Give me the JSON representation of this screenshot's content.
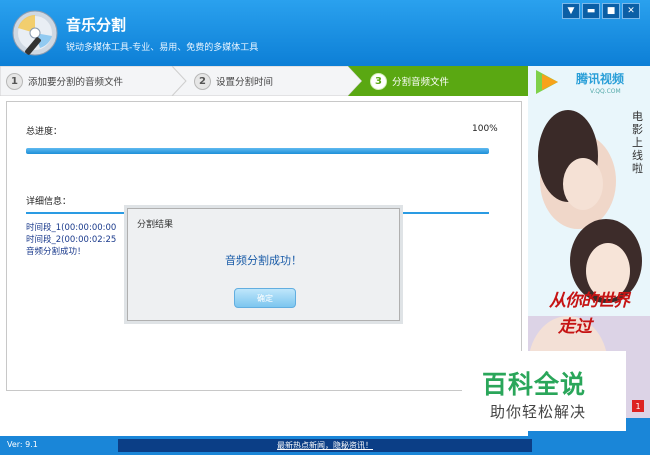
{
  "app": {
    "title": "音乐分割",
    "subtitle": "锐动多媒体工具-专业、易用、免费的多媒体工具"
  },
  "window_controls": {
    "menu_icon": "menu-icon",
    "minimize_icon": "minimize-icon",
    "maximize_icon": "maximize-icon",
    "close_icon": "close-icon"
  },
  "steps": [
    {
      "num": "1",
      "label": "添加要分割的音频文件",
      "active": false
    },
    {
      "num": "2",
      "label": "设置分割时间",
      "active": false
    },
    {
      "num": "3",
      "label": "分割音频文件",
      "active": true
    }
  ],
  "progress": {
    "label": "总进度：",
    "percent_text": "100%",
    "value": 1.0
  },
  "details": {
    "label": "详细信息：",
    "log": [
      "时间段_1(00:00:00:00",
      "时间段_2(00:00:02:25",
      "音频分割成功！"
    ]
  },
  "dialog": {
    "title": "分割结果",
    "message": "音频分割成功！",
    "ok_label": "确定"
  },
  "ad": {
    "brand": "腾讯视频",
    "url": "V.QQ.COM",
    "vertical_text": "电影上线啦",
    "headline": "从你的世界",
    "headline2": "走过",
    "badge": "1"
  },
  "watermark": {
    "main": "百科全说",
    "sub": "助你轻松解决"
  },
  "status": {
    "version": "Ver: 9.1",
    "news": "最新热点新闻，隐秘资讯！"
  },
  "colors": {
    "accent": "#1a86d8",
    "active_step": "#5aa812",
    "progress": "#1d8fd8",
    "ad_headline": "#c61414",
    "watermark_green": "#2aa65a"
  }
}
